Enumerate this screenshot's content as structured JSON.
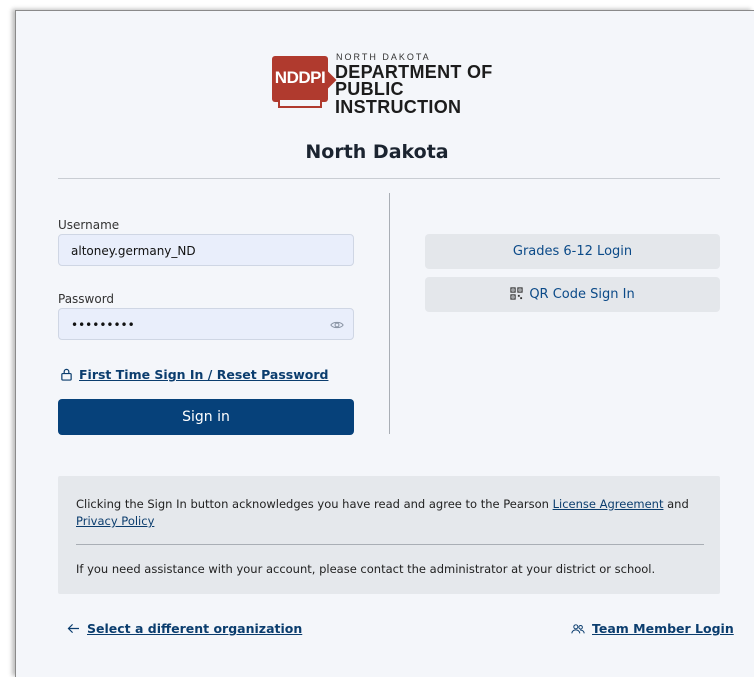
{
  "logo": {
    "badge": "NDDPI",
    "small": "NORTH DAKOTA",
    "line1": "DEPARTMENT OF",
    "line2": "PUBLIC INSTRUCTION"
  },
  "org_title": "North Dakota",
  "form": {
    "username_label": "Username",
    "username_value": "altoney.germany_ND",
    "password_label": "Password",
    "password_value": "•••••••••",
    "reset_link": "First Time Sign In / Reset Password",
    "sign_in": "Sign in"
  },
  "alt_logins": {
    "grades": "Grades 6-12 Login",
    "qr": "QR Code Sign In"
  },
  "notice": {
    "text_before": "Clicking the Sign In button acknowledges you have read and agree to the Pearson ",
    "license": "License Agreement",
    "and": " and ",
    "privacy": "Privacy Policy",
    "assist": "If you need assistance with your account, please contact the administrator at your district or school."
  },
  "footer": {
    "different_org": "Select a different organization",
    "team_member": "Team Member Login"
  },
  "colors": {
    "primary": "#06417a",
    "link": "#0b3d6e",
    "logo_red": "#b03a2e"
  }
}
